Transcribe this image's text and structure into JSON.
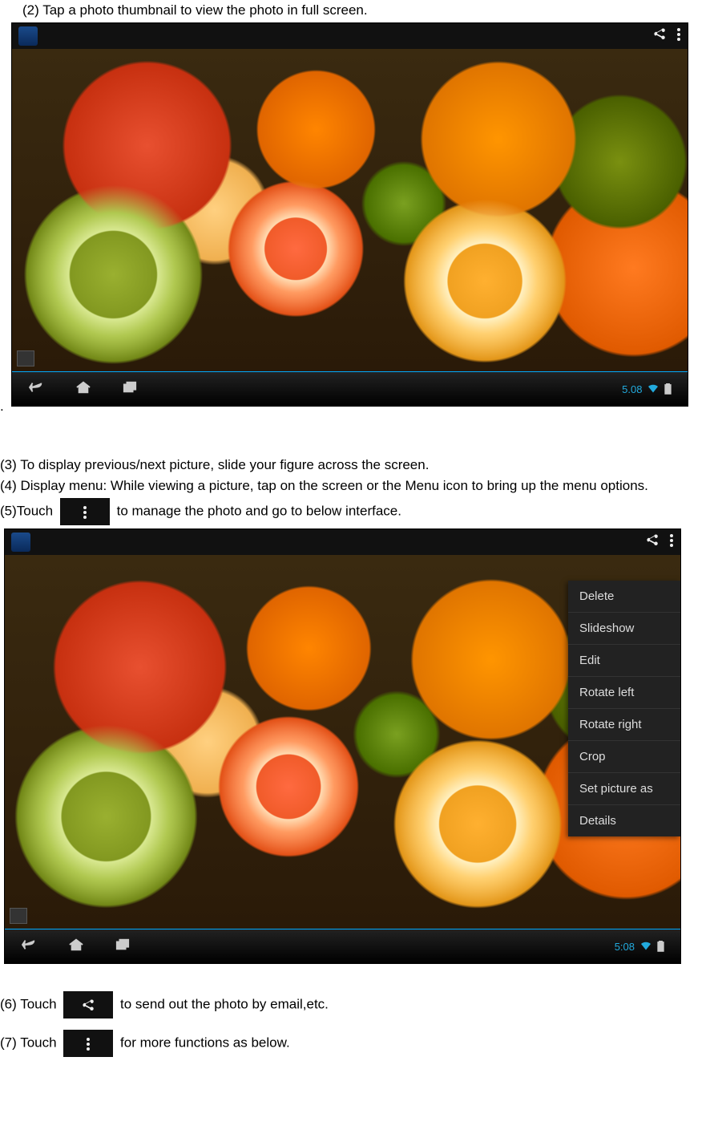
{
  "steps": {
    "s2": "(2)   Tap a photo thumbnail to view the photo in full screen.",
    "s3": "(3) To display previous/next picture, slide your figure across the screen.",
    "s4": "(4) Display menu: While viewing a picture, tap on the screen or the Menu icon to bring up the menu options.",
    "s5_before": "(5)Touch",
    "s5_after": " to manage the photo and go to below interface.",
    "s6_before": "(6) Touch ",
    "s6_after": " to send out the photo by email,etc.",
    "s7_before": "(7) Touch ",
    "s7_after": " for more functions as below."
  },
  "statusbar": {
    "time1": "5.08",
    "time2": "5:08"
  },
  "menu": {
    "items": [
      "Delete",
      "Slideshow",
      "Edit",
      "Rotate left",
      "Rotate right",
      "Crop",
      "Set picture as",
      "Details"
    ]
  },
  "icons": {
    "share": "share-icon",
    "overflow": "menu-dots-icon"
  }
}
